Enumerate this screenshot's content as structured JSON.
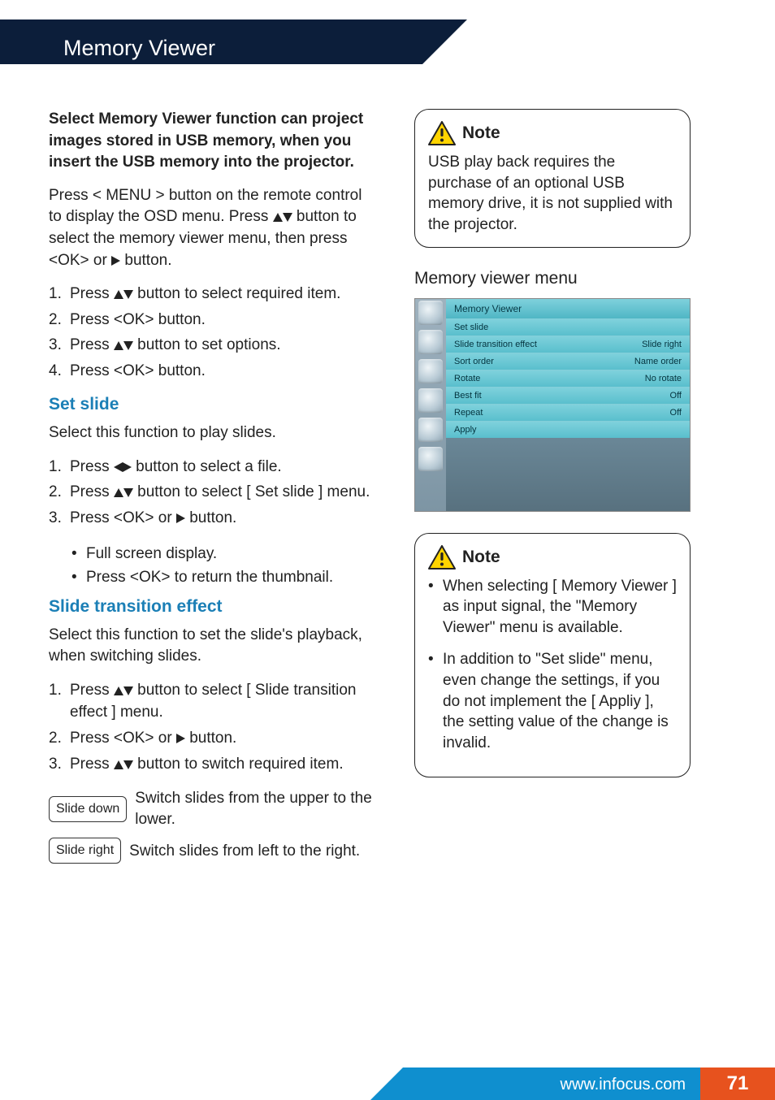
{
  "header": {
    "title": "Memory Viewer"
  },
  "left": {
    "intro": "Select Memory Viewer function can project images stored in USB memory, when you insert the USB memory into the projector.",
    "nav_a": "Press < MENU > button on the remote control to display the OSD menu. Press ",
    "nav_b": " button to select the memory viewer menu, then press <OK> or ",
    "nav_c": " button.",
    "steps_main": [
      {
        "a": "Press ",
        "b": " button to select required item.",
        "arrows": "ud"
      },
      {
        "a": "Press <OK> button.",
        "b": "",
        "arrows": ""
      },
      {
        "a": "Press ",
        "b": " button to set options.",
        "arrows": "ud"
      },
      {
        "a": "Press <OK> button.",
        "b": "",
        "arrows": ""
      }
    ],
    "set_slide": {
      "title": "Set slide",
      "desc": "Select this function to play slides.",
      "steps": [
        {
          "a": "Press ",
          "b": " button to select a file.",
          "arrows": "lr"
        },
        {
          "a": "Press ",
          "b": " button to select [ Set slide ] menu.",
          "arrows": "ud"
        },
        {
          "a": "Press <OK> or ",
          "b": " button.",
          "arrows": "r"
        }
      ],
      "sub": [
        "Full screen display.",
        "Press <OK> to return the thumbnail."
      ]
    },
    "transition": {
      "title": "Slide transition effect",
      "desc": "Select this function to set the slide's playback, when switching slides.",
      "steps": [
        {
          "a": "Press ",
          "b": " button to select [ Slide transition effect ] menu.",
          "arrows": "ud"
        },
        {
          "a": "Press <OK> or ",
          "b": " button.",
          "arrows": "r"
        },
        {
          "a": "Press ",
          "b": " button to switch required item.",
          "arrows": "ud"
        }
      ],
      "options": [
        {
          "label": "Slide down",
          "desc": "Switch slides from the upper to the lower."
        },
        {
          "label": "Slide right",
          "desc": "Switch slides from left to the right."
        }
      ]
    }
  },
  "right": {
    "note1": {
      "title": "Note",
      "body": "USB play back requires the purchase of an optional USB memory drive, it is not supplied with the projector."
    },
    "panel_title": "Memory viewer menu",
    "menu": {
      "header": "Memory Viewer",
      "rows": [
        {
          "l": "Set slide",
          "r": ""
        },
        {
          "l": "Slide transition effect",
          "r": "Slide right"
        },
        {
          "l": "Sort order",
          "r": "Name order"
        },
        {
          "l": "Rotate",
          "r": "No rotate"
        },
        {
          "l": "Best fit",
          "r": "Off"
        },
        {
          "l": "Repeat",
          "r": "Off"
        },
        {
          "l": "Apply",
          "r": ""
        }
      ]
    },
    "note2": {
      "title": "Note",
      "items": [
        "When selecting [ Memory Viewer ] as input signal, the \"Memory Viewer\" menu is available.",
        "In addition to \"Set slide\" menu, even change the settings, if you do not implement the [ Appliy ], the setting value of the change is invalid."
      ]
    }
  },
  "footer": {
    "url": "www.infocus.com",
    "page": "71"
  }
}
